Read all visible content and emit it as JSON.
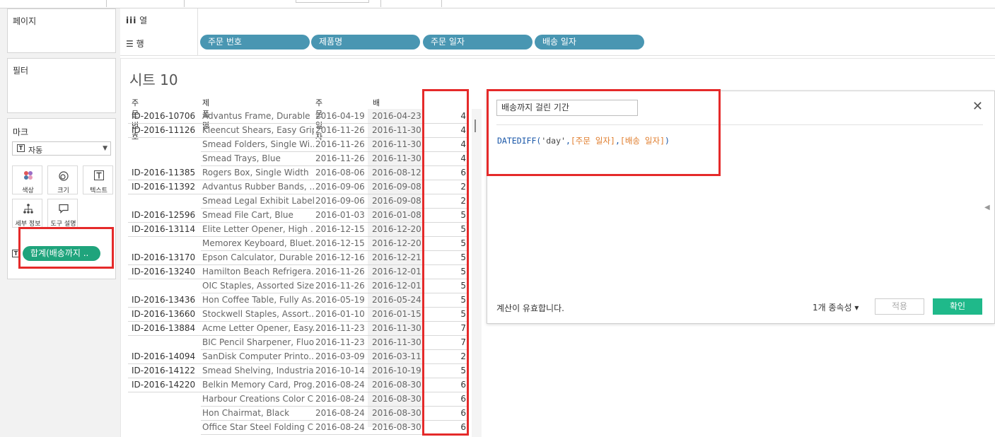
{
  "left": {
    "pages_title": "페이지",
    "filters_title": "필터",
    "marks_title": "마크",
    "mark_type": "자동",
    "mark_buttons": [
      "색상",
      "크기",
      "텍스트",
      "세부 정보",
      "도구 설명"
    ],
    "measure_pill": "합계(배송까지 .."
  },
  "shelves": {
    "columns_label": "열",
    "rows_label": "행",
    "row_pills": [
      "주문 번호",
      "제품명",
      "주문 일자",
      "배송 일자"
    ]
  },
  "sheet": {
    "title": "시트 10",
    "headers": [
      "주문 번호",
      "제품명",
      "주문 일자",
      "배송 일자"
    ],
    "rows": [
      {
        "id": "ID-2016-10706",
        "product": "Advantus Frame, Durable",
        "order": "2016-04-19",
        "ship": "2016-04-23",
        "days": "4"
      },
      {
        "id": "ID-2016-11126",
        "product": "Kleencut Shears, Easy Grip",
        "order": "2016-11-26",
        "ship": "2016-11-30",
        "days": "4"
      },
      {
        "id": "",
        "product": "Smead Folders, Single Wi..",
        "order": "2016-11-26",
        "ship": "2016-11-30",
        "days": "4"
      },
      {
        "id": "",
        "product": "Smead Trays, Blue",
        "order": "2016-11-26",
        "ship": "2016-11-30",
        "days": "4"
      },
      {
        "id": "ID-2016-11385",
        "product": "Rogers Box, Single Width",
        "order": "2016-08-06",
        "ship": "2016-08-12",
        "days": "6"
      },
      {
        "id": "ID-2016-11392",
        "product": "Advantus Rubber Bands, ..",
        "order": "2016-09-06",
        "ship": "2016-09-08",
        "days": "2"
      },
      {
        "id": "",
        "product": "Smead Legal Exhibit Label..",
        "order": "2016-09-06",
        "ship": "2016-09-08",
        "days": "2"
      },
      {
        "id": "ID-2016-12596",
        "product": "Smead File Cart, Blue",
        "order": "2016-01-03",
        "ship": "2016-01-08",
        "days": "5"
      },
      {
        "id": "ID-2016-13114",
        "product": "Elite Letter Opener, High ..",
        "order": "2016-12-15",
        "ship": "2016-12-20",
        "days": "5"
      },
      {
        "id": "",
        "product": "Memorex Keyboard, Bluet..",
        "order": "2016-12-15",
        "ship": "2016-12-20",
        "days": "5"
      },
      {
        "id": "ID-2016-13170",
        "product": "Epson Calculator, Durable",
        "order": "2016-12-16",
        "ship": "2016-12-21",
        "days": "5"
      },
      {
        "id": "ID-2016-13240",
        "product": "Hamilton Beach Refrigera..",
        "order": "2016-11-26",
        "ship": "2016-12-01",
        "days": "5"
      },
      {
        "id": "",
        "product": "OIC Staples, Assorted Sizes",
        "order": "2016-11-26",
        "ship": "2016-12-01",
        "days": "5"
      },
      {
        "id": "ID-2016-13436",
        "product": "Hon Coffee Table, Fully As..",
        "order": "2016-05-19",
        "ship": "2016-05-24",
        "days": "5"
      },
      {
        "id": "ID-2016-13660",
        "product": "Stockwell Staples, Assort..",
        "order": "2016-01-10",
        "ship": "2016-01-15",
        "days": "5"
      },
      {
        "id": "ID-2016-13884",
        "product": "Acme Letter Opener, Easy..",
        "order": "2016-11-23",
        "ship": "2016-11-30",
        "days": "7"
      },
      {
        "id": "",
        "product": "BIC Pencil Sharpener, Fluo..",
        "order": "2016-11-23",
        "ship": "2016-11-30",
        "days": "7"
      },
      {
        "id": "ID-2016-14094",
        "product": "SanDisk Computer Printo..",
        "order": "2016-03-09",
        "ship": "2016-03-11",
        "days": "2"
      },
      {
        "id": "ID-2016-14122",
        "product": "Smead Shelving, Industrial",
        "order": "2016-10-14",
        "ship": "2016-10-19",
        "days": "5"
      },
      {
        "id": "ID-2016-14220",
        "product": "Belkin Memory Card, Prog..",
        "order": "2016-08-24",
        "ship": "2016-08-30",
        "days": "6"
      },
      {
        "id": "",
        "product": "Harbour Creations Color C..",
        "order": "2016-08-24",
        "ship": "2016-08-30",
        "days": "6"
      },
      {
        "id": "",
        "product": "Hon Chairmat, Black",
        "order": "2016-08-24",
        "ship": "2016-08-30",
        "days": "6"
      },
      {
        "id": "",
        "product": "Office Star Steel Folding C..",
        "order": "2016-08-24",
        "ship": "2016-08-30",
        "days": "6"
      }
    ]
  },
  "calc": {
    "name": "배송까지 걸린 기간",
    "formula_fn": "DATEDIFF(",
    "formula_arg": "'day'",
    "formula_comma1": ",",
    "formula_field1": "[주문 일자]",
    "formula_comma2": ",",
    "formula_field2": "[배송 일자]",
    "formula_close": ")",
    "status": "계산이 유효합니다.",
    "dependencies": "1개 종속성 ▾",
    "apply_label": "적용",
    "ok_label": "확인"
  },
  "colors": {
    "shelf_pill": "#4996b2",
    "measure_pill": "#1fa47c",
    "highlight": "#e52a2a",
    "ok_button": "#1fb98a"
  }
}
